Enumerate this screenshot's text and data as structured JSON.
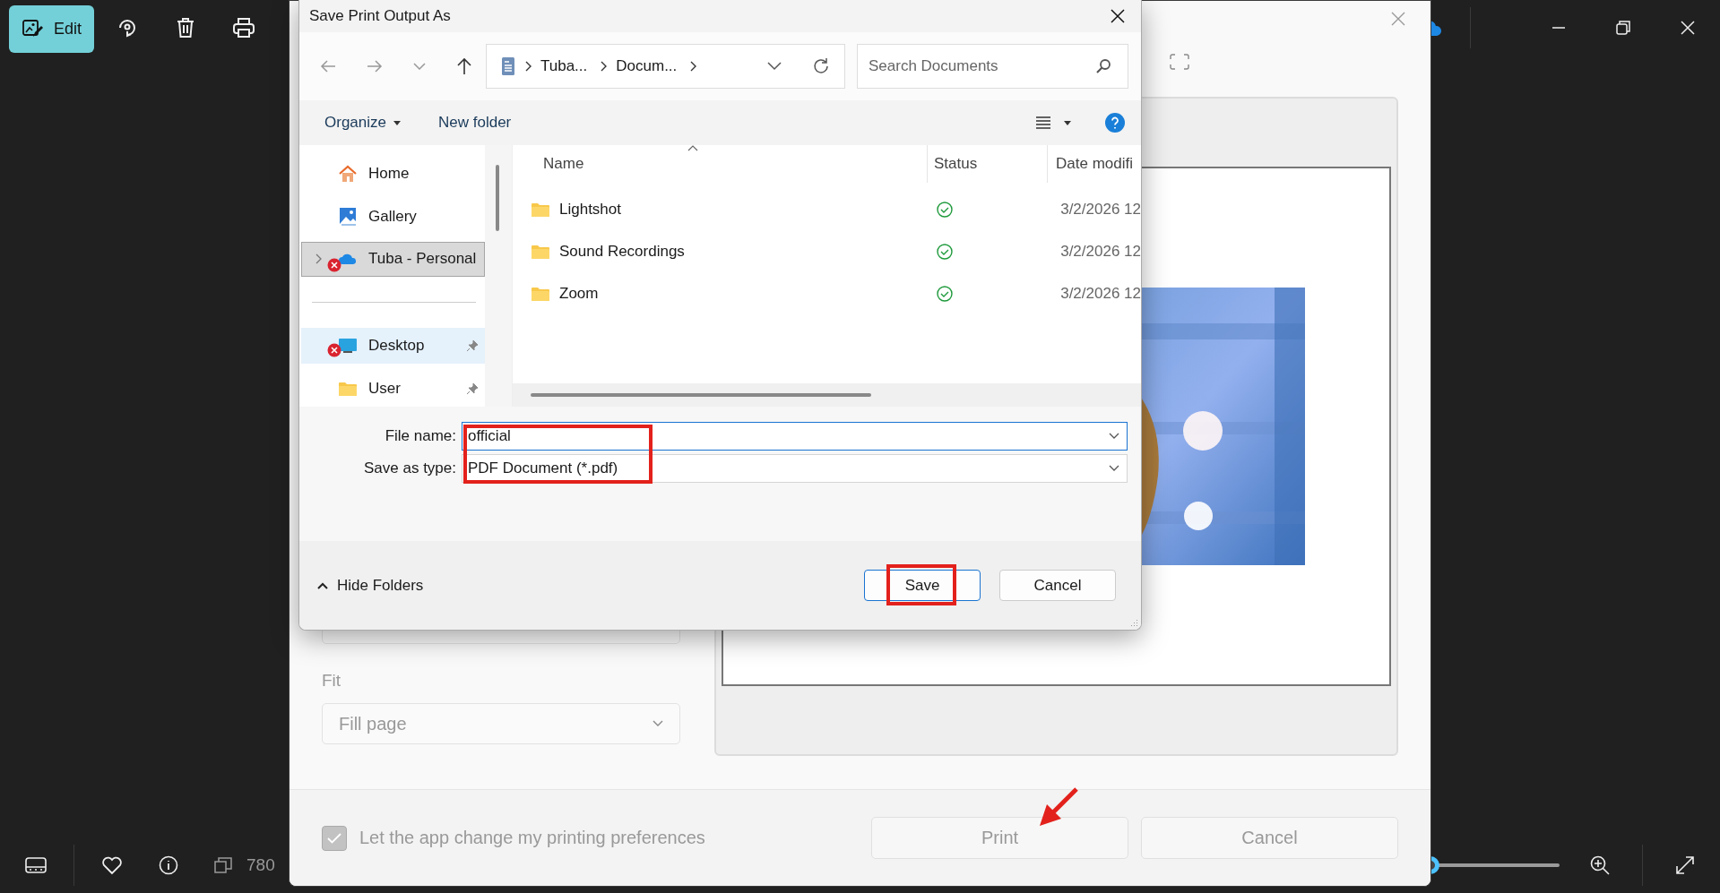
{
  "app_toolbar": {
    "edit_button": "Edit"
  },
  "app_status": {
    "dimensions": "780",
    "zoom_slider": {
      "level": 0.24
    }
  },
  "print_dialog": {
    "fit_label": "Fit",
    "fit_value": "Fill page",
    "preferences_checkbox": {
      "label": "Let the app change my printing preferences",
      "checked": true,
      "disabled": true
    },
    "buttons": [
      {
        "label": "Print",
        "disabled": true
      },
      {
        "label": "Cancel",
        "disabled": true
      }
    ]
  },
  "save_dialog": {
    "title": "Save Print Output As",
    "breadcrumb": [
      "Tuba...",
      "Docum..."
    ],
    "search": {
      "placeholder": "Search Documents"
    },
    "toolbar": [
      "Organize",
      "New folder"
    ],
    "nav_items": [
      {
        "label": "Home",
        "kind": "home",
        "selected": false,
        "hovered": false,
        "expandable": false,
        "error": false,
        "pinned": false
      },
      {
        "label": "Gallery",
        "kind": "gallery",
        "selected": false,
        "hovered": false,
        "expandable": false,
        "error": false,
        "pinned": false
      },
      {
        "label": "Tuba - Personal",
        "kind": "cloud",
        "selected": true,
        "hovered": false,
        "expandable": true,
        "error": true,
        "pinned": false
      },
      {
        "label": "Desktop",
        "kind": "desktop",
        "selected": false,
        "hovered": true,
        "expandable": false,
        "error": true,
        "pinned": true
      },
      {
        "label": "User",
        "kind": "folder",
        "selected": false,
        "hovered": false,
        "expandable": false,
        "error": false,
        "pinned": true
      }
    ],
    "columns": [
      "Name",
      "Status",
      "Date modifi"
    ],
    "rows": [
      {
        "name": "Lightshot",
        "kind": "synced",
        "date": "3/2/2026 12"
      },
      {
        "name": "Sound Recordings",
        "kind": "synced",
        "date": "3/2/2026 12"
      },
      {
        "name": "Zoom",
        "kind": "synced",
        "date": "3/2/2026 12"
      }
    ],
    "file_name_label": "File name:",
    "file_name": "official",
    "type_label": "Save as type:",
    "save_as_type": "PDF Document (*.pdf)",
    "hide_folders": "Hide Folders",
    "buttons": [
      {
        "label": "Save",
        "kind": "primary"
      },
      {
        "label": "Cancel",
        "kind": "secondary"
      }
    ]
  }
}
